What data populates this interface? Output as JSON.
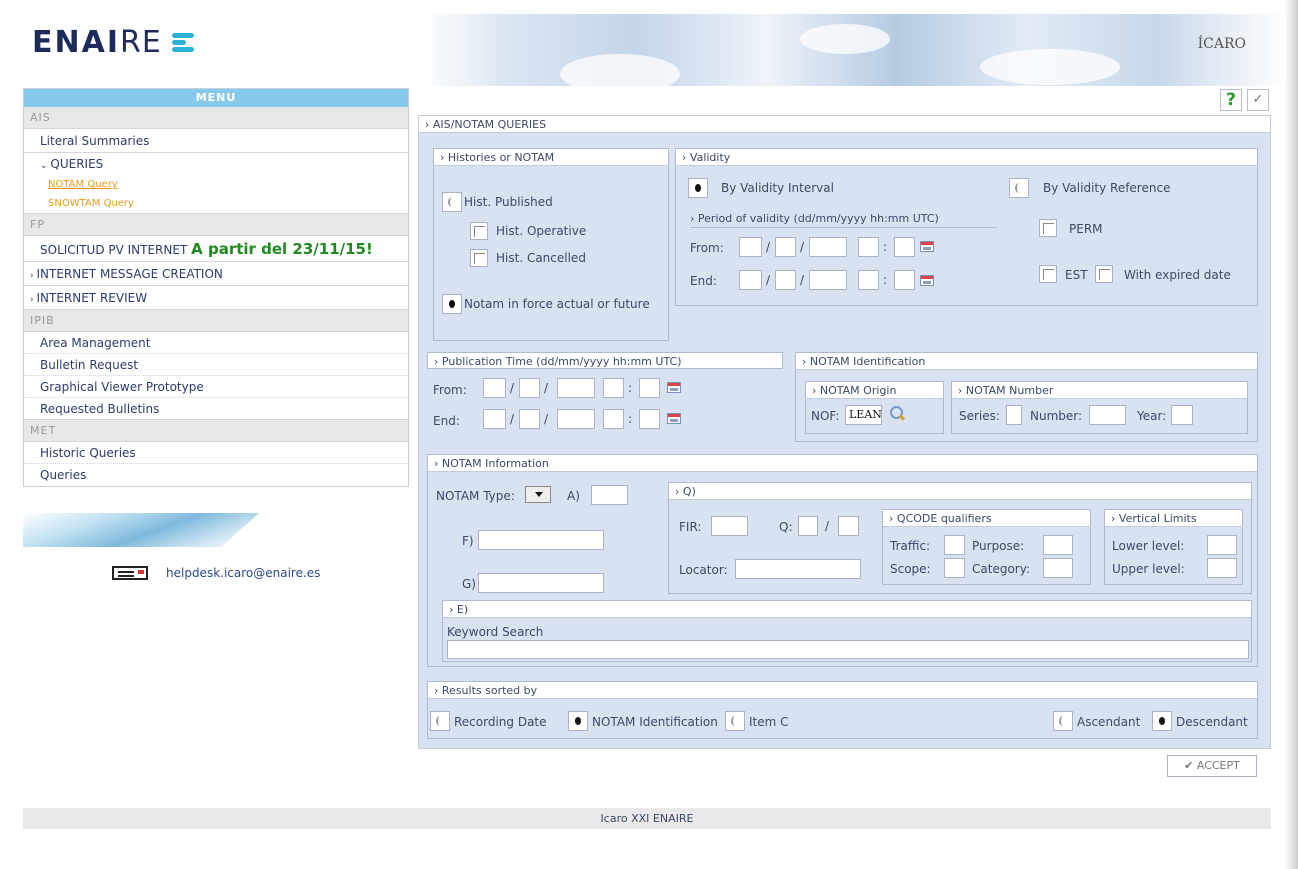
{
  "header": {
    "logo_text_bold": "ENAI",
    "logo_text_light": "RE",
    "brand_right": "ÍCARO"
  },
  "menu": {
    "title": "MENU",
    "sections": {
      "ais": "AIS",
      "fp": "FP",
      "ipib": "IPIB",
      "met": "MET"
    },
    "literal_summaries": "Literal Summaries",
    "queries": "QUERIES",
    "notam_query": "NOTAM Query",
    "snowtam_query": "SNOWTAM Query",
    "solicitud": "SOLICITUD PV INTERNET",
    "solicitud_highlight": "A partir del 23/11/15!",
    "internet_message_creation": "INTERNET MESSAGE CREATION",
    "internet_review": "INTERNET REVIEW",
    "area_management": "Area Management",
    "bulletin_request": "Bulletin Request",
    "graphical_viewer": "Graphical Viewer Prototype",
    "requested_bulletins": "Requested Bulletins",
    "historic_queries": "Historic Queries",
    "met_queries": "Queries"
  },
  "helpdesk": "helpdesk.icaro@enaire.es",
  "form": {
    "title": "AIS/NOTAM QUERIES",
    "histories": {
      "title": "Histories or NOTAM",
      "hist_published": "Hist. Published",
      "hist_operative": "Hist. Operative",
      "hist_cancelled": "Hist. Cancelled",
      "notam_in_force": "Notam in force actual or future"
    },
    "validity": {
      "title": "Validity",
      "by_interval": "By Validity Interval",
      "by_reference": "By Validity Reference",
      "period_title": "Period of validity (dd/mm/yyyy hh:mm UTC)",
      "from": "From:",
      "end": "End:",
      "perm": "PERM",
      "est": "EST",
      "with_expired": "With expired date"
    },
    "publication": {
      "title": "Publication Time (dd/mm/yyyy hh:mm UTC)",
      "from": "From:",
      "end": "End:"
    },
    "notam_identification": {
      "title": "NOTAM Identification",
      "origin_title": "NOTAM Origin",
      "nof_label": "NOF:",
      "nof_value": "LEAN",
      "number_title": "NOTAM Number",
      "series": "Series:",
      "number": "Number:",
      "year": "Year:"
    },
    "notam_information": {
      "title": "NOTAM Information",
      "notam_type": "NOTAM Type:",
      "a": "A)",
      "f": "F)",
      "g": "G)",
      "q_title": "Q)",
      "fir": "FIR:",
      "q": "Q:",
      "locator": "Locator:",
      "qcode_title": "QCODE qualifiers",
      "traffic": "Traffic:",
      "purpose": "Purpose:",
      "scope": "Scope:",
      "category": "Category:",
      "vertical_title": "Vertical Limits",
      "lower": "Lower level:",
      "upper": "Upper level:",
      "e_title": "E)",
      "keyword": "Keyword Search"
    },
    "results": {
      "title": "Results sorted by",
      "recording_date": "Recording Date",
      "notam_identification": "NOTAM Identification",
      "item_c": "Item C",
      "ascendant": "Ascendant",
      "descendant": "Descendant"
    },
    "accept": "ACCEPT"
  },
  "footer": "Icaro XXI ENAIRE",
  "colors": {
    "menu_header": "#87c9ea",
    "panel_bg": "#d8e2f0",
    "menu_link": "#2c3d6c",
    "active_sub": "#e89a20",
    "highlight_green": "#1f8a1f"
  }
}
